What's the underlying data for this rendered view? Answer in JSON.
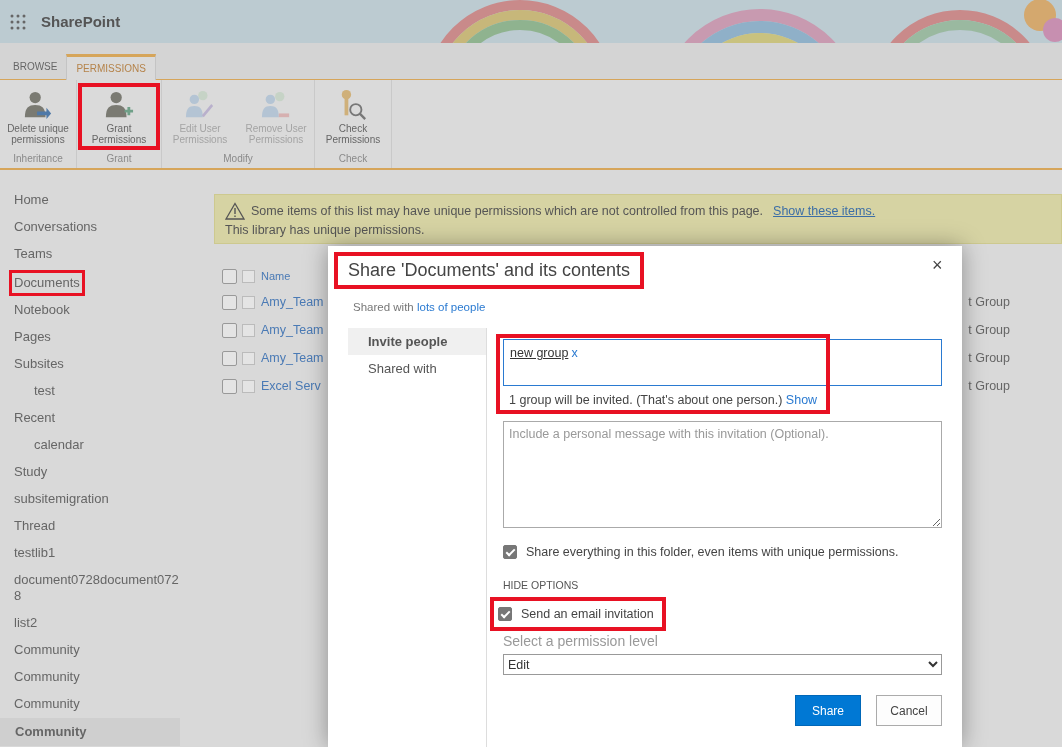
{
  "suite_bar": {
    "title": "SharePoint"
  },
  "ribbon": {
    "tabs": [
      {
        "label": "BROWSE",
        "selected": false
      },
      {
        "label": "PERMISSIONS",
        "selected": true
      }
    ],
    "groups": [
      {
        "label": "Inheritance",
        "buttons": [
          {
            "label": "Delete unique permissions",
            "disabled": false,
            "highlighted": false
          }
        ]
      },
      {
        "label": "Grant",
        "buttons": [
          {
            "label": "Grant Permissions",
            "disabled": false,
            "highlighted": true
          }
        ]
      },
      {
        "label": "Modify",
        "buttons": [
          {
            "label": "Edit User Permissions",
            "disabled": true,
            "highlighted": false
          },
          {
            "label": "Remove User Permissions",
            "disabled": true,
            "highlighted": false
          }
        ]
      },
      {
        "label": "Check",
        "buttons": [
          {
            "label": "Check Permissions",
            "disabled": false,
            "highlighted": false
          }
        ]
      }
    ]
  },
  "sidebar": {
    "items": [
      {
        "label": "Home",
        "selected": false,
        "highlighted": false
      },
      {
        "label": "Conversations",
        "selected": false,
        "highlighted": false
      },
      {
        "label": "Teams",
        "selected": false,
        "highlighted": false
      },
      {
        "label": "Documents",
        "selected": false,
        "highlighted": true
      },
      {
        "label": "Notebook",
        "selected": false,
        "highlighted": false
      },
      {
        "label": "Pages",
        "selected": false,
        "highlighted": false
      },
      {
        "label": "Subsites",
        "selected": false,
        "highlighted": false,
        "children": [
          {
            "label": "test",
            "selected": false,
            "highlighted": false
          }
        ]
      },
      {
        "label": "Recent",
        "selected": false,
        "highlighted": false,
        "children": [
          {
            "label": "calendar",
            "selected": false,
            "highlighted": false
          }
        ]
      },
      {
        "label": "Study",
        "selected": false,
        "highlighted": false
      },
      {
        "label": "subsitemigration",
        "selected": false,
        "highlighted": false
      },
      {
        "label": "Thread",
        "selected": false,
        "highlighted": false
      },
      {
        "label": "testlib1",
        "selected": false,
        "highlighted": false
      },
      {
        "label": "document0728document0728",
        "selected": false,
        "highlighted": false
      },
      {
        "label": "list2",
        "selected": false,
        "highlighted": false
      },
      {
        "label": "Community",
        "selected": false,
        "highlighted": false
      },
      {
        "label": "Community",
        "selected": false,
        "highlighted": false
      },
      {
        "label": "Community",
        "selected": false,
        "highlighted": false
      },
      {
        "label": "Community",
        "selected": true,
        "highlighted": false
      }
    ]
  },
  "warning": {
    "message": "Some items of this list may have unique permissions which are not controlled from this page.",
    "link": "Show these items.",
    "note": "This library has unique permissions."
  },
  "list": {
    "header": {
      "checked": false,
      "item_checked": false,
      "name": "Name"
    },
    "rows": [
      {
        "checked": false,
        "item_checked": false,
        "name": "Amy_Team",
        "column_2": "t Group"
      },
      {
        "checked": false,
        "item_checked": false,
        "name": "Amy_Team",
        "column_2": "t Group"
      },
      {
        "checked": false,
        "item_checked": false,
        "name": "Amy_Team",
        "column_2": "t Group"
      },
      {
        "checked": false,
        "item_checked": false,
        "name": "Excel Serv",
        "column_2": "t Group"
      }
    ]
  },
  "dialog": {
    "title": "Share 'Documents' and its contents",
    "title_highlighted": true,
    "close": "×",
    "shared_with_prefix": "Shared with",
    "shared_with_link": "lots of people",
    "nav": [
      {
        "label": "Invite people",
        "selected": true
      },
      {
        "label": "Shared with",
        "selected": false
      }
    ],
    "invite_highlighted": true,
    "recipients": [
      {
        "name": "new group",
        "remove": "x"
      }
    ],
    "invite_summary": "1 group will be invited. (That's about one person.)",
    "show_link": "Show",
    "message_placeholder": "Include a personal message with this invitation (Optional).",
    "share_everything": {
      "label": "Share everything in this folder, even items with unique permissions.",
      "checked": true
    },
    "options_toggle": "HIDE OPTIONS",
    "send_email": {
      "label": "Send an email invitation",
      "checked": true,
      "highlighted": true
    },
    "permission_label": "Select a permission level",
    "permission_value": "Edit",
    "buttons": [
      {
        "label": "Share",
        "kind": "primary"
      },
      {
        "label": "Cancel",
        "kind": "secondary"
      }
    ]
  }
}
